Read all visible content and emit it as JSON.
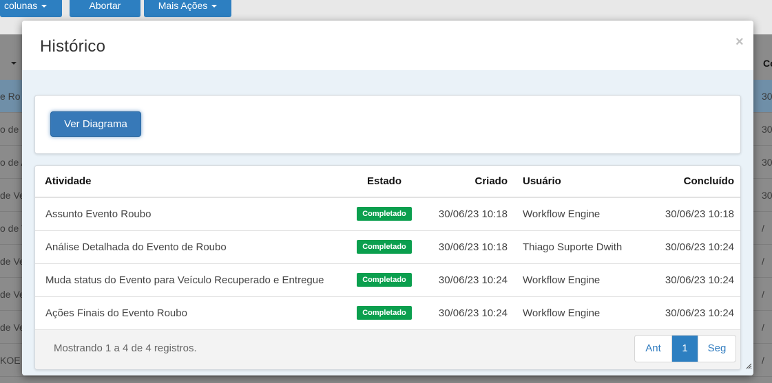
{
  "background": {
    "toolbar_buttons": [
      {
        "label": "colunas"
      },
      {
        "label": "Abortar"
      },
      {
        "label": "Mais Ações"
      }
    ],
    "table_header_right": "Co",
    "rows_left": [
      "e Ro",
      "o de E",
      "o de A",
      "de Ve",
      "o de V",
      "de Ve",
      "de Ve",
      "de Ve",
      "KOE"
    ],
    "rows_right": [
      "30",
      "30",
      "30",
      "30",
      "/",
      "/",
      "/",
      "/",
      "/"
    ]
  },
  "modal": {
    "title": "Histórico",
    "close_symbol": "×",
    "diagram_button": "Ver Diagrama",
    "table": {
      "headers": {
        "activity": "Atividade",
        "state": "Estado",
        "created": "Criado",
        "user": "Usuário",
        "completed": "Concluído"
      },
      "rows": [
        {
          "activity": "Assunto Evento Roubo",
          "state": "Completado",
          "created": "30/06/23 10:18",
          "user": "Workflow Engine",
          "completed": "30/06/23 10:18"
        },
        {
          "activity": "Análise Detalhada do Evento de Roubo",
          "state": "Completado",
          "created": "30/06/23 10:18",
          "user": "Thiago Suporte Dwith",
          "completed": "30/06/23 10:24"
        },
        {
          "activity": "Muda status do Evento para Veículo Recuperado e Entregue",
          "state": "Completado",
          "created": "30/06/23 10:24",
          "user": "Workflow Engine",
          "completed": "30/06/23 10:24"
        },
        {
          "activity": "Ações Finais do Evento Roubo",
          "state": "Completado",
          "created": "30/06/23 10:24",
          "user": "Workflow Engine",
          "completed": "30/06/23 10:24"
        }
      ]
    },
    "footer": {
      "info": "Mostrando 1 a 4 de 4 registros.",
      "prev": "Ant",
      "page": "1",
      "next": "Seg"
    }
  }
}
